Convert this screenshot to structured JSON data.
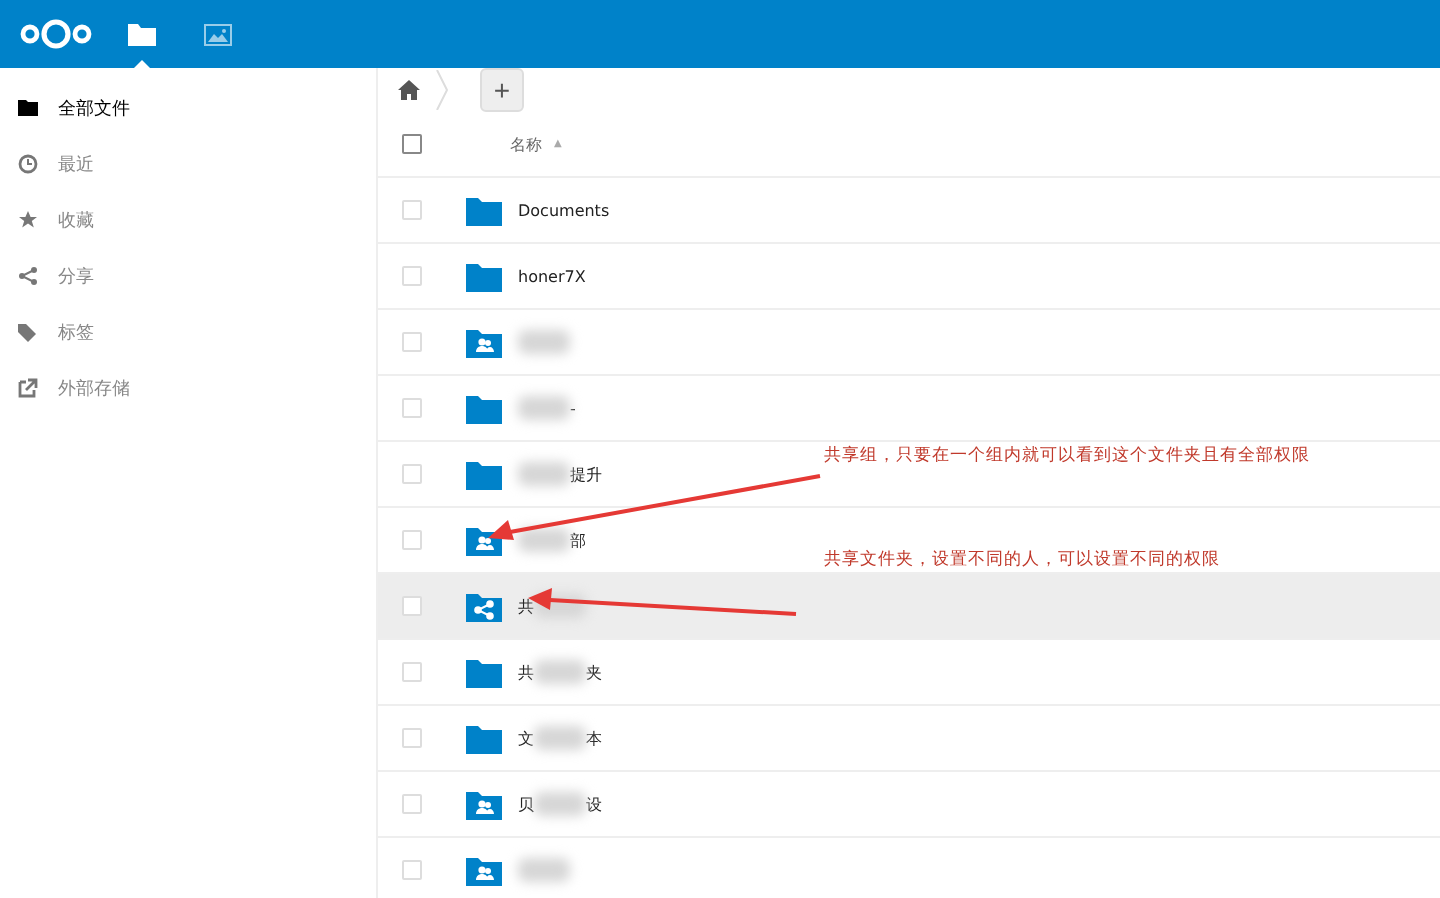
{
  "header": {
    "apps": [
      {
        "kind": "files",
        "selected": true
      },
      {
        "kind": "gallery",
        "selected": false
      }
    ]
  },
  "sidebar": {
    "items": [
      {
        "kind": "folder",
        "label": "全部文件",
        "selected": true
      },
      {
        "kind": "clock",
        "label": "最近",
        "selected": false
      },
      {
        "kind": "star",
        "label": "收藏",
        "selected": false
      },
      {
        "kind": "share",
        "label": "分享",
        "selected": false
      },
      {
        "kind": "tag",
        "label": "标签",
        "selected": false
      },
      {
        "kind": "external",
        "label": "外部存储",
        "selected": false
      }
    ]
  },
  "breadcrumb": {
    "add_button": "+"
  },
  "table": {
    "select_all": {
      "checked": false
    },
    "columns": [
      {
        "label": "名称",
        "sort": "▲"
      }
    ],
    "rows": [
      {
        "kind": "folder",
        "highlighted": false,
        "name": [
          {
            "kind": "text",
            "text": "Documents"
          }
        ]
      },
      {
        "kind": "folder",
        "highlighted": false,
        "name": [
          {
            "kind": "text",
            "text": "honer7X"
          }
        ]
      },
      {
        "kind": "group",
        "highlighted": false,
        "name": [
          {
            "kind": "blur"
          }
        ]
      },
      {
        "kind": "folder",
        "highlighted": false,
        "name": [
          {
            "kind": "blur"
          },
          {
            "kind": "text",
            "text": "-"
          }
        ]
      },
      {
        "kind": "folder",
        "highlighted": false,
        "name": [
          {
            "kind": "blur"
          },
          {
            "kind": "text",
            "text": "提升"
          }
        ]
      },
      {
        "kind": "group",
        "highlighted": false,
        "name": [
          {
            "kind": "blur"
          },
          {
            "kind": "text",
            "text": "部"
          }
        ]
      },
      {
        "kind": "shared",
        "highlighted": true,
        "name": [
          {
            "kind": "text",
            "text": "共"
          },
          {
            "kind": "blur"
          }
        ]
      },
      {
        "kind": "folder",
        "highlighted": false,
        "name": [
          {
            "kind": "text",
            "text": "共"
          },
          {
            "kind": "blur"
          },
          {
            "kind": "text",
            "text": "夹"
          }
        ]
      },
      {
        "kind": "folder",
        "highlighted": false,
        "name": [
          {
            "kind": "text",
            "text": "文"
          },
          {
            "kind": "blur"
          },
          {
            "kind": "text",
            "text": "本"
          }
        ]
      },
      {
        "kind": "group",
        "highlighted": false,
        "name": [
          {
            "kind": "text",
            "text": "贝"
          },
          {
            "kind": "blur"
          },
          {
            "kind": "text",
            "text": "设"
          }
        ]
      },
      {
        "kind": "group",
        "highlighted": false,
        "name": [
          {
            "kind": "blur"
          }
        ]
      }
    ]
  },
  "annotations": [
    {
      "text": "共享组，只要在一个组内就可以看到这个文件夹且有全部权限"
    },
    {
      "text": "共享文件夹，设置不同的人，可以设置不同的权限"
    }
  ]
}
